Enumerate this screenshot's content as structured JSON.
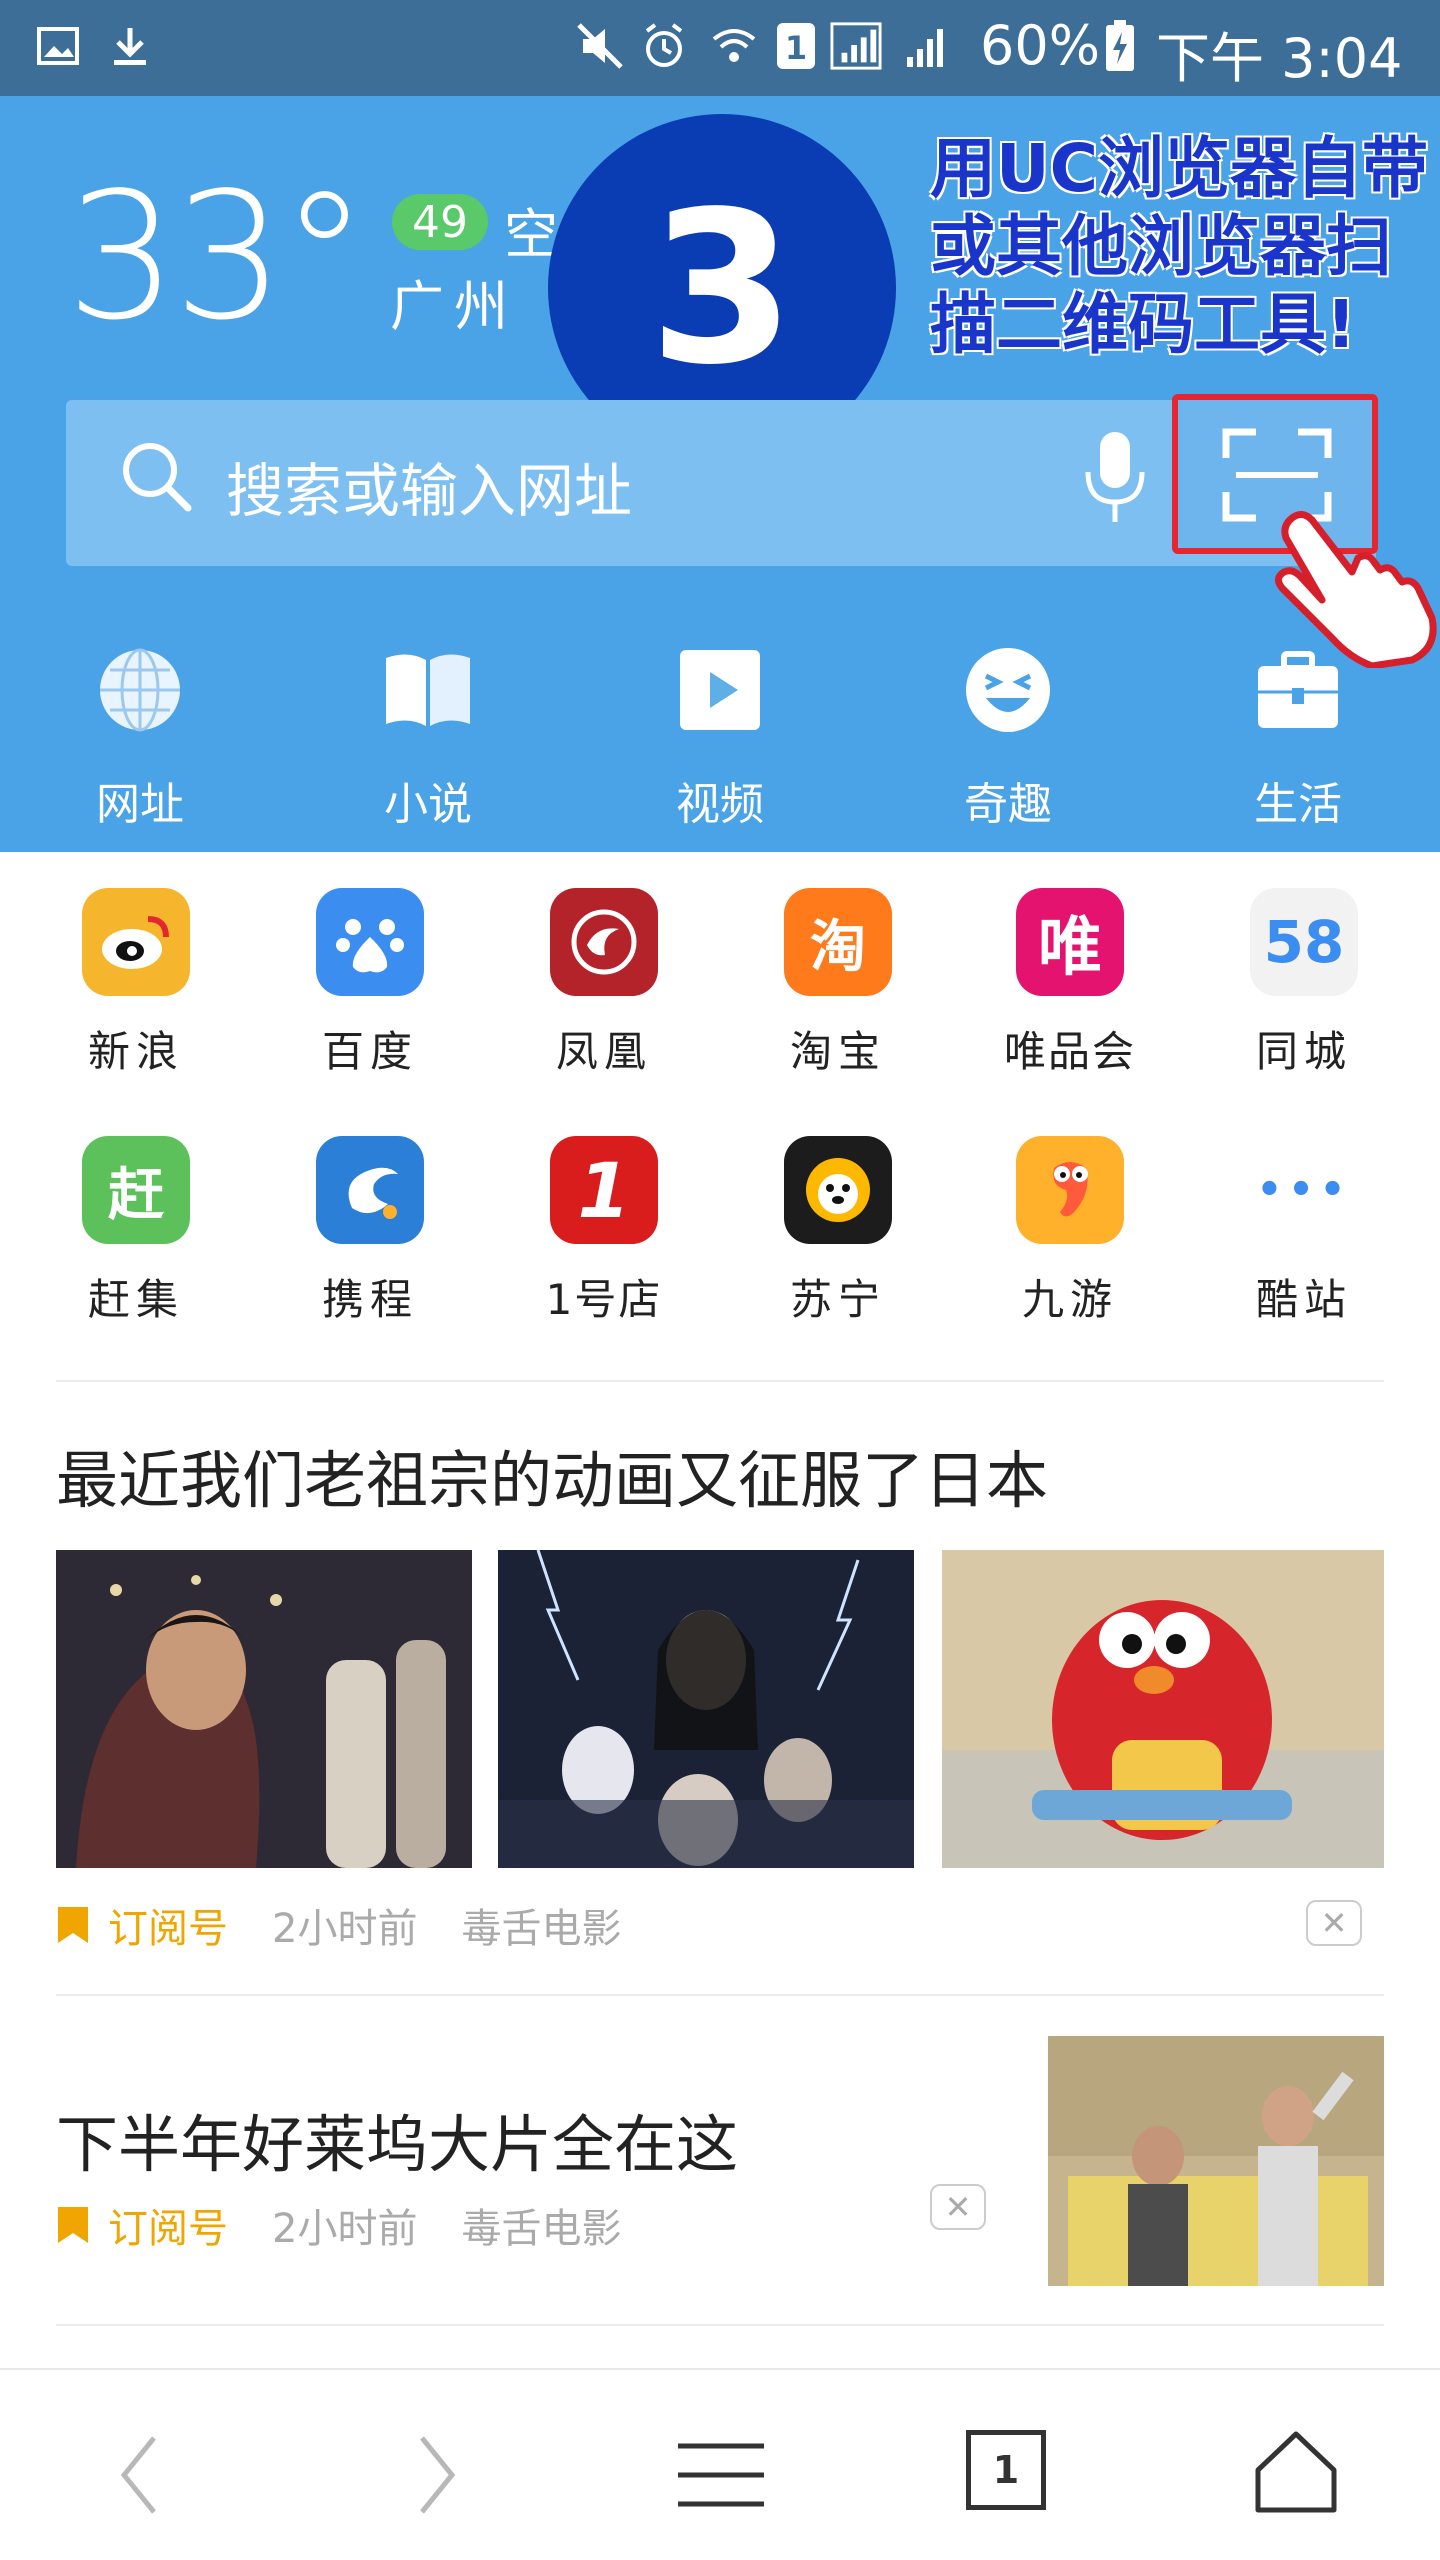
{
  "status_bar": {
    "battery": "60%",
    "time": "下午 3:04",
    "sim_badge": "1"
  },
  "weather": {
    "temperature": "33°",
    "aqi_value": "49",
    "aqi_label": "空气",
    "city": "广州 雷"
  },
  "overlay": {
    "step_number": "3",
    "annotation": "用UC浏览器自带或其他浏览器扫描二维码工具!"
  },
  "search": {
    "placeholder": "搜索或输入网址"
  },
  "categories": [
    {
      "label": "网址",
      "icon": "globe-icon"
    },
    {
      "label": "小说",
      "icon": "book-icon"
    },
    {
      "label": "视频",
      "icon": "video-play-icon"
    },
    {
      "label": "奇趣",
      "icon": "laugh-face-icon"
    },
    {
      "label": "生活",
      "icon": "toolbox-icon"
    }
  ],
  "sites": [
    {
      "name": "新浪",
      "logo": "sina-logo",
      "color": "#f5b62e"
    },
    {
      "name": "百度",
      "logo": "baidu-logo",
      "color": "#3b8df0"
    },
    {
      "name": "凤凰",
      "logo": "ifeng-logo",
      "color": "#b4232a"
    },
    {
      "name": "淘宝",
      "logo": "taobao-logo",
      "glyph": "淘",
      "color": "#ff7a1a"
    },
    {
      "name": "唯品会",
      "logo": "vip-logo",
      "glyph": "唯",
      "color": "#e3136f"
    },
    {
      "name": "同城",
      "logo": "58-logo",
      "glyph": "58",
      "color": "#f2f2f2"
    },
    {
      "name": "赶集",
      "logo": "ganji-logo",
      "glyph": "赶",
      "color": "#5cc15b"
    },
    {
      "name": "携程",
      "logo": "ctrip-logo",
      "color": "#2c7fd6"
    },
    {
      "name": "1号店",
      "logo": "yhd-logo",
      "glyph": "1",
      "color": "#d91d1d"
    },
    {
      "name": "苏宁",
      "logo": "suning-logo",
      "color": "#1c1c1c"
    },
    {
      "name": "九游",
      "logo": "jiuyou-logo",
      "color": "#ffb12b"
    },
    {
      "name": "酷站",
      "logo": "more-dots-icon",
      "glyph": "•••",
      "color": "#ffffff"
    }
  ],
  "feed": [
    {
      "title": "最近我们老祖宗的动画又征服了日本",
      "tag": "订阅号",
      "time": "2小时前",
      "source": "毒舌电影"
    },
    {
      "title": "下半年好莱坞大片全在这",
      "tag": "订阅号",
      "time": "2小时前",
      "source": "毒舌电影"
    }
  ],
  "toolbar": {
    "tab_count": "1"
  },
  "colors": {
    "header_bg": "#4aa3e6",
    "status_bg": "#3c6e98",
    "accent_tag": "#f0a500",
    "step_circle": "#0a3cb4",
    "highlight_red": "#e5252f"
  }
}
